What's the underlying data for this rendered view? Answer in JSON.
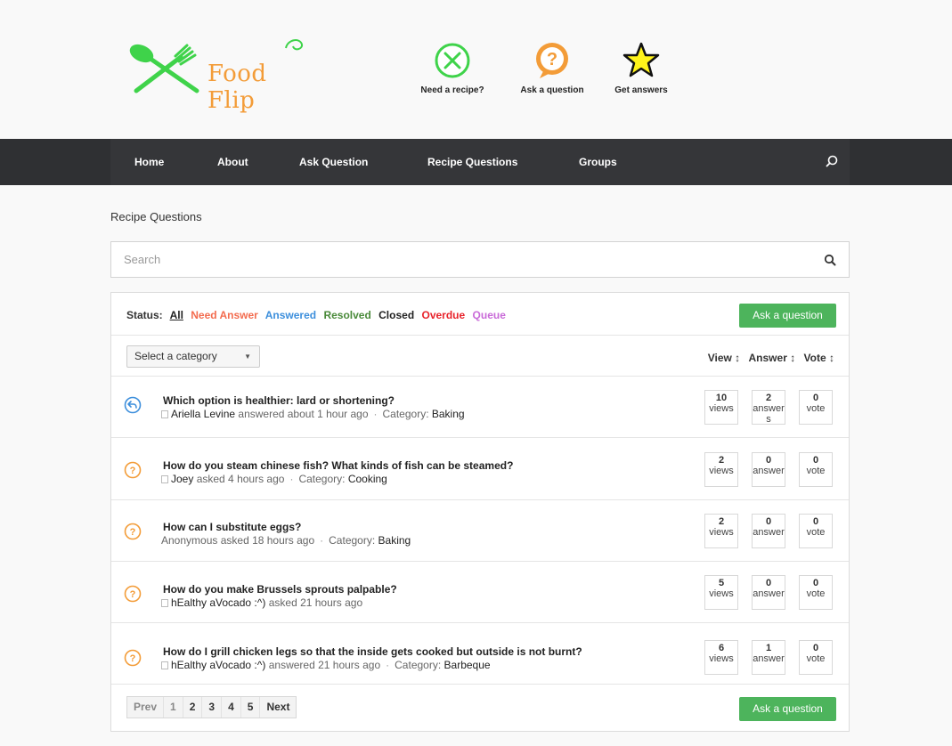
{
  "brand": {
    "name": "Food Flip"
  },
  "features": [
    {
      "label": "Need a recipe?",
      "icon": "fork-knife-circle-icon"
    },
    {
      "label": "Ask a question",
      "icon": "question-bubble-icon"
    },
    {
      "label": "Get answers",
      "icon": "star-icon"
    }
  ],
  "nav": {
    "items": [
      "Home",
      "About",
      "Ask Question",
      "Recipe Questions",
      "Groups"
    ],
    "search_icon": "search-icon"
  },
  "page": {
    "title": "Recipe Questions"
  },
  "search": {
    "placeholder": "Search"
  },
  "status": {
    "label": "Status:",
    "filters": [
      {
        "label": "All",
        "color": "#222222"
      },
      {
        "label": "Need Answer",
        "color": "#f36c4f"
      },
      {
        "label": "Answered",
        "color": "#3d8fdc"
      },
      {
        "label": "Resolved",
        "color": "#4a8a3a"
      },
      {
        "label": "Closed",
        "color": "#222222"
      },
      {
        "label": "Overdue",
        "color": "#e8232b"
      },
      {
        "label": "Queue",
        "color": "#c96ad8"
      }
    ],
    "ask_button": "Ask a question"
  },
  "filter": {
    "category_select": "Select a category",
    "sorts": [
      "View ↕",
      "Answer ↕",
      "Vote ↕"
    ]
  },
  "questions": [
    {
      "title": "Which option is healthier: lard or shortening?",
      "user": "Ariella Levine",
      "action": "answered about 1 hour ago",
      "category_label": "Category:",
      "category": "Baking",
      "status_icon": "reply-arrow-icon",
      "has_avatar": true,
      "views": "10",
      "views_label": "views",
      "answers": "2",
      "answers_label": "answers",
      "votes": "0",
      "votes_label": "vote"
    },
    {
      "title": "How do you steam chinese fish? What kinds of fish can be steamed?",
      "user": "Joey",
      "action": "asked 4 hours ago",
      "category_label": "Category:",
      "category": "Cooking",
      "status_icon": "question-circle-icon",
      "has_avatar": true,
      "views": "2",
      "views_label": "views",
      "answers": "0",
      "answers_label": "answer",
      "votes": "0",
      "votes_label": "vote"
    },
    {
      "title": "How can I substitute eggs?",
      "user": "Anonymous",
      "action": "asked 18 hours ago",
      "category_label": "Category:",
      "category": "Baking",
      "status_icon": "question-circle-icon",
      "has_avatar": false,
      "views": "2",
      "views_label": "views",
      "answers": "0",
      "answers_label": "answer",
      "votes": "0",
      "votes_label": "vote"
    },
    {
      "title": "How do you make Brussels sprouts palpable?",
      "user": "hEalthy aVocado :^)",
      "action": "asked 21 hours ago",
      "category_label": "",
      "category": "",
      "status_icon": "question-circle-icon",
      "has_avatar": true,
      "views": "5",
      "views_label": "views",
      "answers": "0",
      "answers_label": "answer",
      "votes": "0",
      "votes_label": "vote"
    },
    {
      "title": "How do I grill chicken legs so that the inside gets cooked but outside is not burnt?",
      "user": "hEalthy aVocado :^)",
      "action": "answered 21 hours ago",
      "category_label": "Category:",
      "category": "Barbeque",
      "status_icon": "question-circle-icon",
      "has_avatar": true,
      "views": "6",
      "views_label": "views",
      "answers": "1",
      "answers_label": "answer",
      "votes": "0",
      "votes_label": "vote"
    }
  ],
  "pager": [
    "Prev",
    "1",
    "2",
    "3",
    "4",
    "5",
    "Next"
  ],
  "bottom_button": "Ask a question",
  "colors": {
    "brand_green": "#3fd34a",
    "brand_orange": "#f39c38",
    "nav_bg": "#353639",
    "button_green": "#4db45c",
    "question_orange": "#f39c38",
    "answered_blue": "#3d8fdc"
  }
}
